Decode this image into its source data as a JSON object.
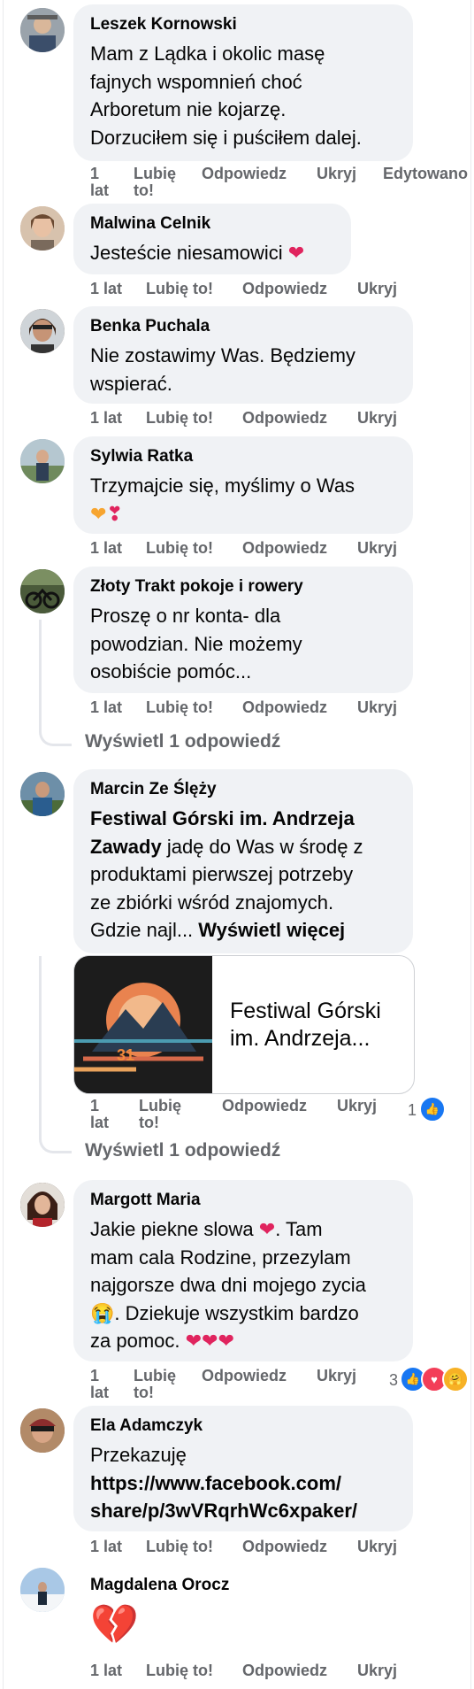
{
  "comments": [
    {
      "author": "Leszek Kornowski",
      "lines": [
        "Mam z Lądka i okolic masę",
        "fajnych wspomnień choć",
        "Arboretum nie kojarzę.",
        "Dorzuciłem się i puściłem dalej."
      ],
      "time": "1 lat",
      "like": "Lubię to!",
      "reply": "Odpowiedz",
      "hide": "Ukryj",
      "edited": "Edytowano"
    },
    {
      "author": "Malwina Celnik",
      "lines": [
        "Jesteście niesamowici"
      ],
      "time": "1 lat",
      "like": "Lubię to!",
      "reply": "Odpowiedz",
      "hide": "Ukryj"
    },
    {
      "author": "Benka Puchala",
      "lines": [
        "Nie zostawimy Was. Będziemy",
        "wspierać."
      ],
      "time": "1 lat",
      "like": "Lubię to!",
      "reply": "Odpowiedz",
      "hide": "Ukryj"
    },
    {
      "author": "Sylwia Ratka",
      "lines": [
        "Trzymajcie się, myślimy o Was"
      ],
      "time": "1 lat",
      "like": "Lubię to!",
      "reply": "Odpowiedz",
      "hide": "Ukryj"
    },
    {
      "author": "Złoty Trakt pokoje i rowery",
      "lines": [
        "Proszę o nr konta- dla",
        "powodzian. Nie możemy",
        "osobiście pomóc..."
      ],
      "time": "1 lat",
      "like": "Lubię to!",
      "reply": "Odpowiedz",
      "hide": "Ukryj",
      "view_replies": "Wyświetl 1 odpowiedź"
    },
    {
      "author": "Marcin Ze Ślęży",
      "tag1": "Festiwal Górski im. Andrzeja",
      "tag2": "Zawady",
      "line2_rest": " jadę do Was w środę z",
      "line3": "produktami pierwszej potrzeby",
      "line4": "ze zbiórki wśród znajomych.",
      "line5": "Gdzie najl... ",
      "see_more": "Wyświetl więcej",
      "link_title_1": "Festiwal Górski",
      "link_title_2": "im. Andrzeja...",
      "time": "1 lat",
      "like": "Lubię to!",
      "reply": "Odpowiedz",
      "hide": "Ukryj",
      "reaction_count": "1",
      "view_replies": "Wyświetl 1 odpowiedź"
    },
    {
      "author": "Margott Maria",
      "line1": "Jakie piekne slowa ",
      "line1_rest": ". Tam",
      "line2": "mam cala Rodzine, przezylam",
      "line3": "najgorsze dwa dni mojego zycia",
      "line4_rest": ". Dziekuje wszystkim bardzo",
      "line5": "za pomoc. ",
      "time": "1 lat",
      "like": "Lubię to!",
      "reply": "Odpowiedz",
      "hide": "Ukryj",
      "reaction_count": "3"
    },
    {
      "author": "Ela Adamczyk",
      "lines": [
        "Przekazuję"
      ],
      "link_1": "https://www.facebook.com/",
      "link_2": "share/p/3wVRqrhWc6xpaker/",
      "time": "1 lat",
      "like": "Lubię to!",
      "reply": "Odpowiedz",
      "hide": "Ukryj"
    },
    {
      "author": "Magdalena Orocz",
      "time": "1 lat",
      "like": "Lubię to!",
      "reply": "Odpowiedz",
      "hide": "Ukryj"
    }
  ],
  "time_split": [
    "1",
    "lat"
  ],
  "like_split": [
    "Lubię",
    "to!"
  ],
  "colors": {
    "bubble": "#f0f2f5",
    "meta": "#65676b",
    "like_blue": "#1877f2",
    "heart_red": "#f33e58",
    "care_yellow": "#f7b125"
  }
}
